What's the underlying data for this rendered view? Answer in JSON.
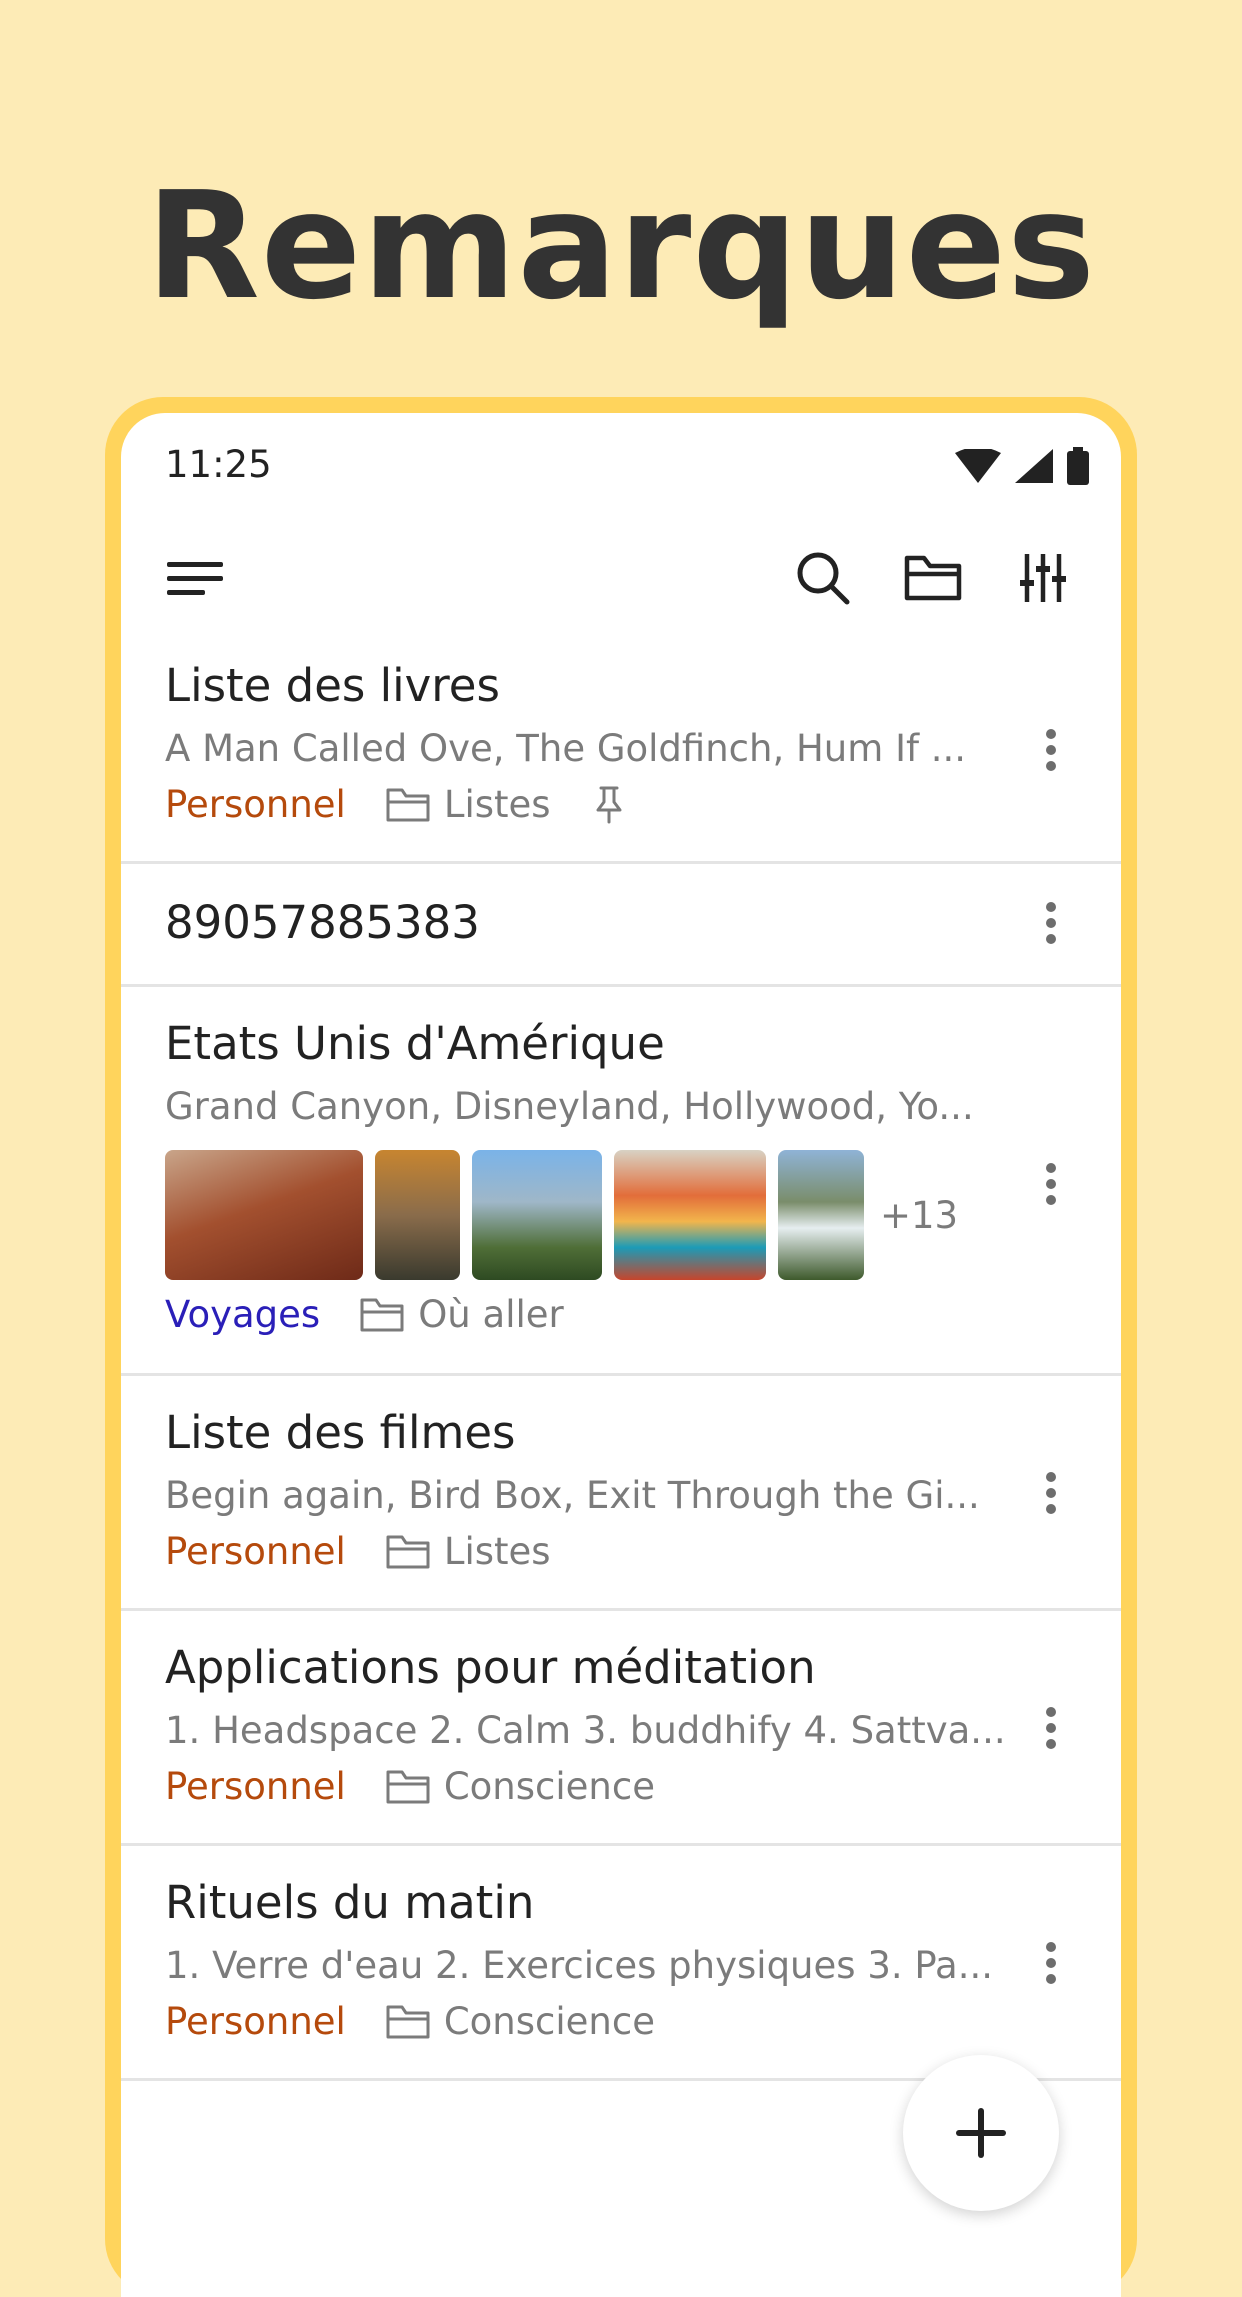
{
  "promo": {
    "title": "Remarques"
  },
  "status_bar": {
    "time": "11:25"
  },
  "colors": {
    "personal": "#b54a0c",
    "travel": "#2a1fb8",
    "accent": "#ffd45c",
    "background": "#fdebb6"
  },
  "toolbar": {
    "icons": [
      "menu-icon",
      "search-icon",
      "folder-icon",
      "filter-sliders-icon"
    ]
  },
  "notes": [
    {
      "title": "Liste des livres",
      "preview": "A Man Called Ove, The Goldfinch, Hum If ...",
      "tag": "Personnel",
      "folder": "Listes",
      "pinned": true
    },
    {
      "title": "89057885383"
    },
    {
      "title": "Etats Unis d'Amérique",
      "preview": "Grand Canyon, Disneyland, Hollywood, Yo...",
      "more_images": "+13",
      "tag": "Voyages",
      "folder": "Où aller"
    },
    {
      "title": "Liste des filmes",
      "preview": "Begin again, Bird Box, Exit Through the Gi...",
      "tag": "Personnel",
      "folder": "Listes"
    },
    {
      "title": "Applications pour méditation",
      "preview": "1. Headspace 2. Calm 3. buddhify 4. Sattva...",
      "tag": "Personnel",
      "folder": "Conscience"
    },
    {
      "title": "Rituels du matin",
      "preview": "1. Verre d'eau 2. Exercices physiques 3. Pa...",
      "tag": "Personnel",
      "folder": "Conscience"
    }
  ]
}
